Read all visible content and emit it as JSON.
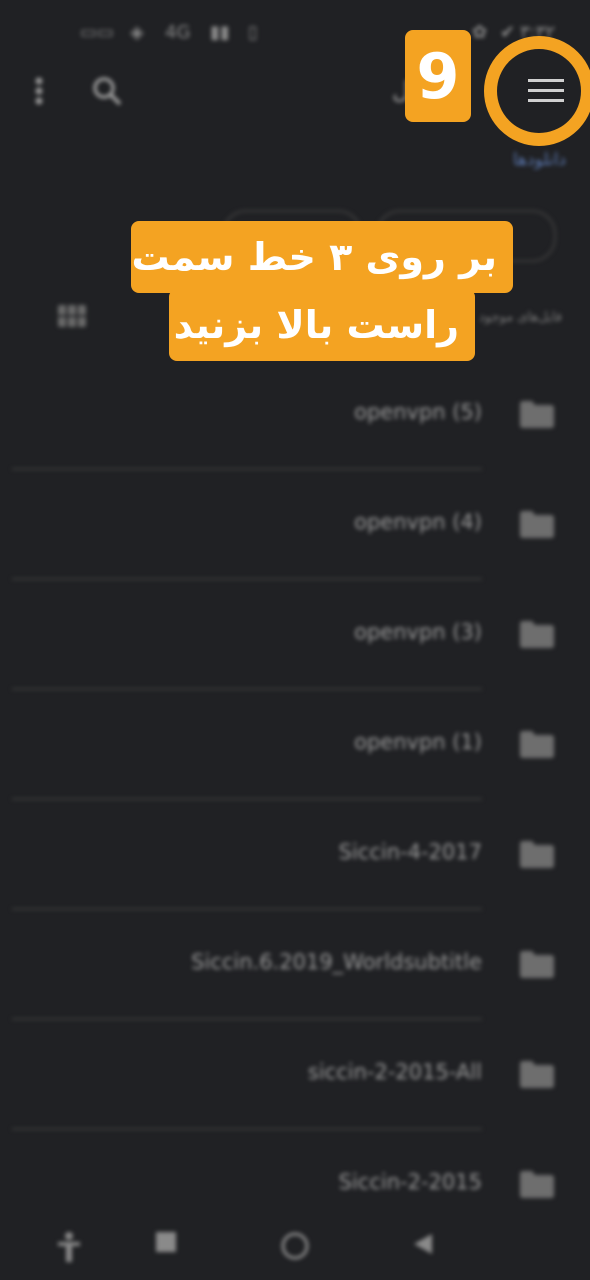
{
  "status_bar": {
    "time": "۳:۳۲",
    "network": "4G"
  },
  "header": {
    "title_fragment": "ل",
    "breadcrumb": "دانلودها"
  },
  "list": {
    "header_label": "فایل‌های موجود",
    "items": [
      {
        "name": "openvpn (5)"
      },
      {
        "name": "openvpn (4)"
      },
      {
        "name": "openvpn (3)"
      },
      {
        "name": "openvpn (1)"
      },
      {
        "name": "Siccin-4-2017"
      },
      {
        "name": "Siccin.6.2019_Worldsubtitle"
      },
      {
        "name": "siccin-2-2015-All"
      },
      {
        "name": "Siccin-2-2015"
      }
    ]
  },
  "annotation": {
    "step_number": "9",
    "line1": "بر روی ۳ خط سمت",
    "line2": "راست بالا بزنید",
    "accent_color": "#f4a322"
  },
  "icons": {
    "menu": "hamburger-menu-icon",
    "search": "search-icon",
    "more": "more-vertical-icon",
    "folder": "folder-icon"
  }
}
